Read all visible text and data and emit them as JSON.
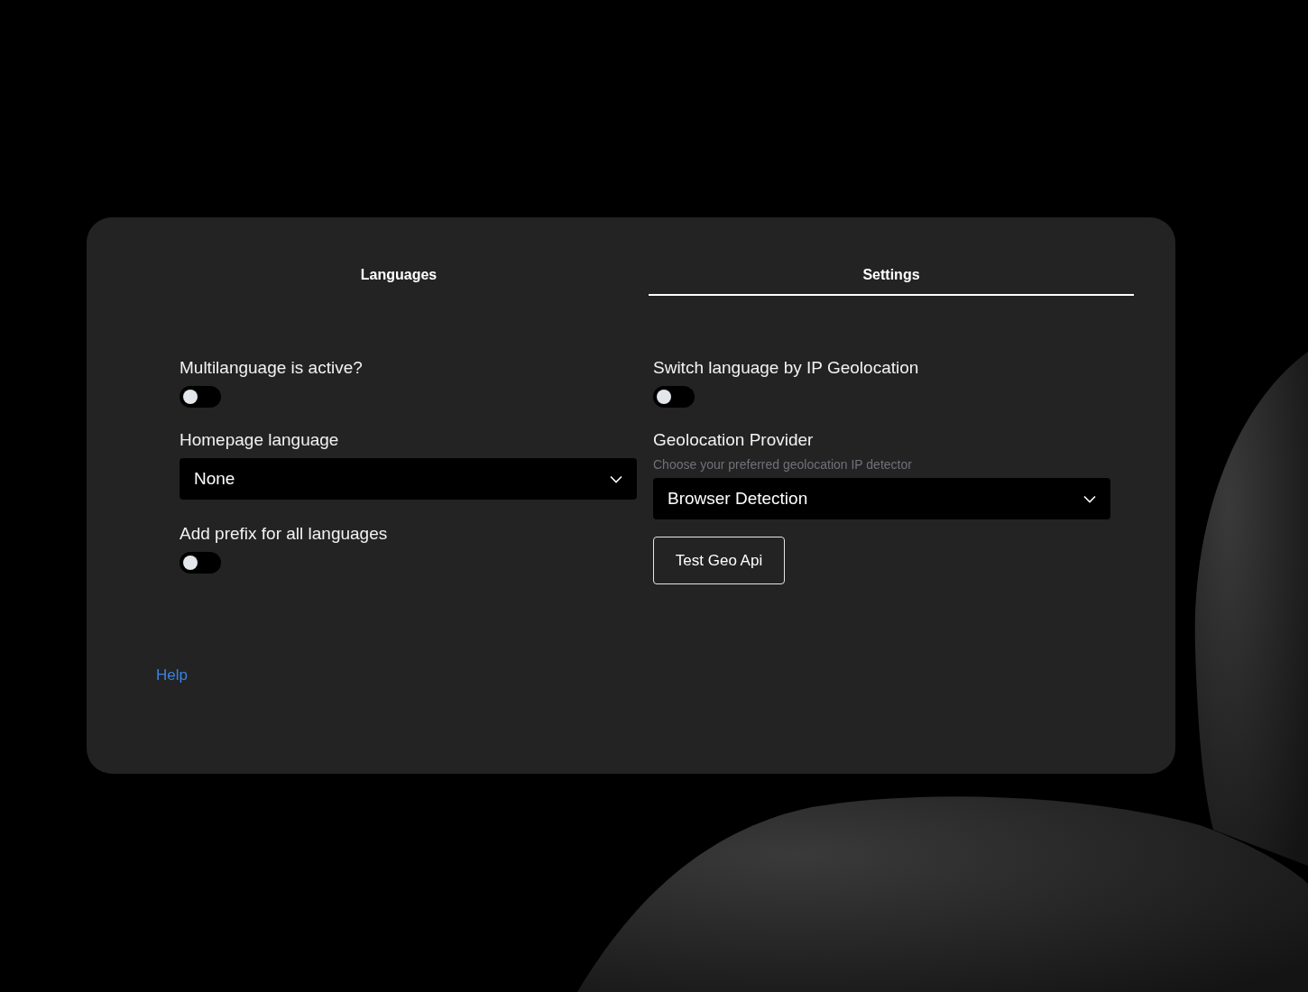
{
  "tabs": [
    {
      "label": "Languages",
      "selected": false
    },
    {
      "label": "Settings",
      "selected": true
    }
  ],
  "columns": [
    [
      {
        "kind": "toggle",
        "label": "Multilanguage is active?",
        "on": false
      },
      {
        "kind": "select",
        "label": "Homepage language",
        "value": "None"
      },
      {
        "kind": "toggle",
        "label": "Add prefix for all languages",
        "on": false
      }
    ],
    [
      {
        "kind": "toggle",
        "label": "Switch language by IP Geolocation",
        "on": false
      },
      {
        "kind": "select",
        "label": "Geolocation Provider",
        "description": "Choose your preferred geolocation IP detector",
        "value": "Browser Detection"
      },
      {
        "kind": "button",
        "label": "Test Geo Api"
      }
    ]
  ],
  "help_link": "Help"
}
